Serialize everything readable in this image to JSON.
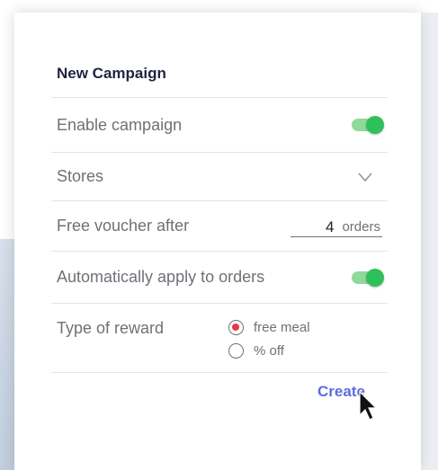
{
  "form": {
    "title": "New Campaign",
    "enable_campaign": {
      "label": "Enable campaign",
      "enabled": true
    },
    "stores": {
      "label": "Stores",
      "icon": "chevron-down-icon"
    },
    "free_voucher": {
      "label": "Free voucher after",
      "value": "4",
      "unit": "orders"
    },
    "auto_apply": {
      "label": "Automatically apply to orders",
      "enabled": true
    },
    "reward": {
      "label": "Type of reward",
      "options": [
        {
          "label": "free meal",
          "selected": true
        },
        {
          "label": "% off",
          "selected": false
        }
      ]
    },
    "create_label": "Create"
  },
  "colors": {
    "toggle_track": "#8fd99a",
    "toggle_knob": "#2ec05a",
    "radio_selected": "#e8394a",
    "accent": "#5b6de0",
    "title": "#1f2440"
  }
}
